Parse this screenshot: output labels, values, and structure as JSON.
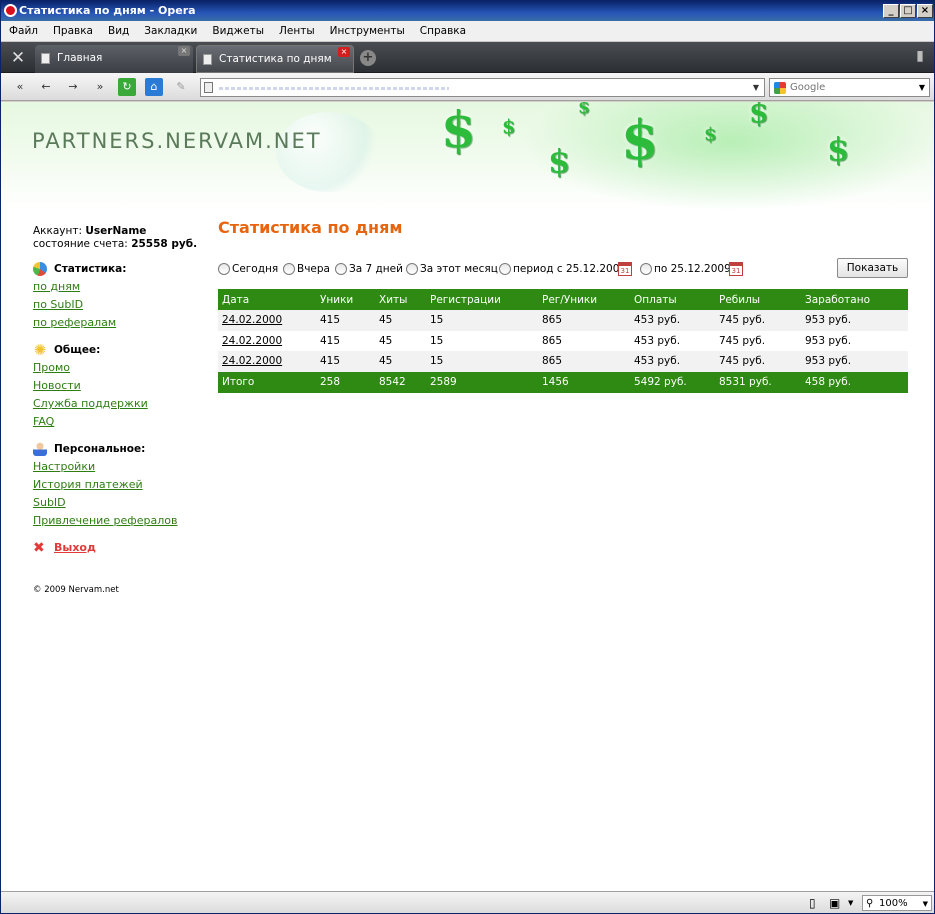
{
  "window": {
    "title": "Статистика по дням - Opera",
    "controls": {
      "minimize": "_",
      "maximize": "□",
      "close": "×"
    }
  },
  "menu": [
    "Файл",
    "Правка",
    "Вид",
    "Закладки",
    "Виджеты",
    "Ленты",
    "Инструменты",
    "Справка"
  ],
  "tabs": [
    {
      "label": "Главная",
      "close": "×"
    },
    {
      "label": "Статистика по дням",
      "close": "×"
    }
  ],
  "newtab": "+",
  "nav": {
    "back_all": "«",
    "back": "←",
    "forward": "→",
    "forward_all": "»",
    "reload": "↻",
    "home": "⌂",
    "edit": "✎"
  },
  "search": {
    "placeholder": "Google",
    "dropdown": "▼"
  },
  "address_dropdown": "▼",
  "site": {
    "logo": "PARTNERS.NERVAM.NET",
    "dollar": "$"
  },
  "sidebar": {
    "account_label": "Аккаунт:",
    "account_name": "UserName",
    "balance_label": "состояние счета:",
    "balance_value": "25558 руб.",
    "sections": [
      {
        "title": "Статистика:",
        "icon": "chart-pie-icon",
        "links": [
          "по дням",
          "по SubID",
          "по рефералам"
        ]
      },
      {
        "title": "Общее:",
        "icon": "star-icon",
        "links": [
          "Промо",
          "Новости",
          "Служба поддержки",
          "FAQ"
        ]
      },
      {
        "title": "Персональное:",
        "icon": "user-icon",
        "links": [
          "Настройки",
          "История платежей",
          "SubID",
          "Привлечение рефералов"
        ]
      }
    ],
    "logout_icon": "✖",
    "logout": "Выход",
    "copyright": "© 2009 Nervam.net"
  },
  "main": {
    "title": "Статистика по дням",
    "filters": {
      "today": "Сегодня",
      "yesterday": "Вчера",
      "week": "За 7 дней",
      "month": "За этот месяц",
      "period_from": "период с 25.12.2009",
      "period_to": "по 25.12.2009",
      "calendar_glyph": "31"
    },
    "show_button": "Показать",
    "table": {
      "headers": [
        "Дата",
        "Уники",
        "Хиты",
        "Регистрации",
        "Рег/Уники",
        "Оплаты",
        "Ребилы",
        "Заработано"
      ],
      "rows": [
        [
          "24.02.2000",
          "415",
          "45",
          "15",
          "865",
          "453 руб.",
          "745 руб.",
          "953 руб."
        ],
        [
          "24.02.2000",
          "415",
          "45",
          "15",
          "865",
          "453 руб.",
          "745 руб.",
          "953 руб."
        ],
        [
          "24.02.2000",
          "415",
          "45",
          "15",
          "865",
          "453 руб.",
          "745 руб.",
          "953 руб."
        ]
      ],
      "total": [
        "Итого",
        "258",
        "8542",
        "2589",
        "1456",
        "5492 руб.",
        "8531 руб.",
        "458 руб."
      ]
    }
  },
  "statusbar": {
    "zoom": "100%",
    "zoom_dropdown": "▼"
  },
  "colors": {
    "accent_green": "#2e8a12",
    "title_orange": "#e8650f",
    "logout_red": "#e23a3a"
  }
}
